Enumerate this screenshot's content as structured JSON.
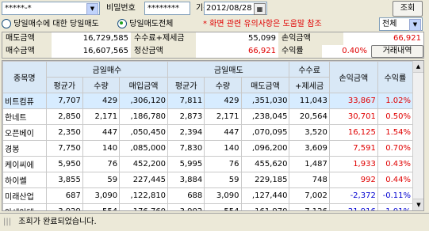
{
  "toolbar": {
    "account_value": "*****-*",
    "password_label": "비밀번호",
    "password_value": "********",
    "date_label": "기준일",
    "date_value": "2012/08/28",
    "query_button": "조회"
  },
  "filter": {
    "radio_today_buy": "당일매수에 대한 당일매도",
    "radio_today_all": "당일매도전체",
    "warning": "* 화면 관련 유의사항은 도움말 참조",
    "select_value": "전체"
  },
  "summary": {
    "sell_amount_label": "매도금액",
    "sell_amount": "16,729,585",
    "fee_tax_label": "수수료+제세금",
    "fee_tax": "55,099",
    "pnl_amount_label": "손익금액",
    "pnl_amount": "66,921",
    "buy_amount_label": "매수금액",
    "buy_amount": "16,607,565",
    "settle_amount_label": "정산금액",
    "settle_amount": "66,921",
    "return_label": "수익률",
    "return_value": "0.40%",
    "history_label": "거래내역"
  },
  "table": {
    "headers": {
      "name": "종목명",
      "buy_group": "금일매수",
      "sell_group": "금일매도",
      "fee_tax": "수수료",
      "fee_tax2": "+제세금",
      "pnl": "손익금액",
      "ret": "수익률",
      "avg": "평균가",
      "qty": "수량",
      "buy_amt": "매입금액",
      "sell_amt": "매도금액"
    },
    "rows": [
      {
        "name": "비트컴퓨",
        "buy_avg": "7,707",
        "buy_qty": "429",
        "buy_amt": ",306,120",
        "sell_avg": "7,811",
        "sell_qty": "429",
        "sell_amt": ",351,030",
        "fee": "11,043",
        "pnl": "33,867",
        "ret": "1.02%"
      },
      {
        "name": "한네트",
        "buy_avg": "2,850",
        "buy_qty": "2,171",
        "buy_amt": ",186,780",
        "sell_avg": "2,873",
        "sell_qty": "2,171",
        "sell_amt": ",238,045",
        "fee": "20,564",
        "pnl": "30,701",
        "ret": "0.50%"
      },
      {
        "name": "오픈베이",
        "buy_avg": "2,350",
        "buy_qty": "447",
        "buy_amt": ",050,450",
        "sell_avg": "2,394",
        "sell_qty": "447",
        "sell_amt": ",070,095",
        "fee": "3,520",
        "pnl": "16,125",
        "ret": "1.54%"
      },
      {
        "name": "경봉",
        "buy_avg": "7,750",
        "buy_qty": "140",
        "buy_amt": ",085,000",
        "sell_avg": "7,830",
        "sell_qty": "140",
        "sell_amt": ",096,200",
        "fee": "3,609",
        "pnl": "7,591",
        "ret": "0.70%"
      },
      {
        "name": "케이씨에",
        "buy_avg": "5,950",
        "buy_qty": "76",
        "buy_amt": "452,200",
        "sell_avg": "5,995",
        "sell_qty": "76",
        "sell_amt": "455,620",
        "fee": "1,487",
        "pnl": "1,933",
        "ret": "0.43%"
      },
      {
        "name": "하이쎌",
        "buy_avg": "3,855",
        "buy_qty": "59",
        "buy_amt": "227,445",
        "sell_avg": "3,884",
        "sell_qty": "59",
        "sell_amt": "229,185",
        "fee": "748",
        "pnl": "992",
        "ret": "0.44%"
      },
      {
        "name": "미래산업",
        "buy_avg": "687",
        "buy_qty": "3,090",
        "buy_amt": ",122,810",
        "sell_avg": "688",
        "sell_qty": "3,090",
        "sell_amt": ",127,440",
        "fee": "7,002",
        "pnl": "-2,372",
        "ret": "-0.11%"
      },
      {
        "name": "아세아텍",
        "buy_avg": "3,929",
        "buy_qty": "554",
        "buy_amt": ",176,760",
        "sell_avg": "3,902",
        "sell_qty": "554",
        "sell_amt": ",161,970",
        "fee": "7,126",
        "pnl": "-21,916",
        "ret": "-1.01%"
      }
    ]
  },
  "status": {
    "message": "조회가 완료되었습니다."
  },
  "colors": {
    "positive": "#e00000",
    "negative": "#0000d0",
    "header_bg": "#d9e8f6",
    "selected_row": "#d7ecff"
  }
}
